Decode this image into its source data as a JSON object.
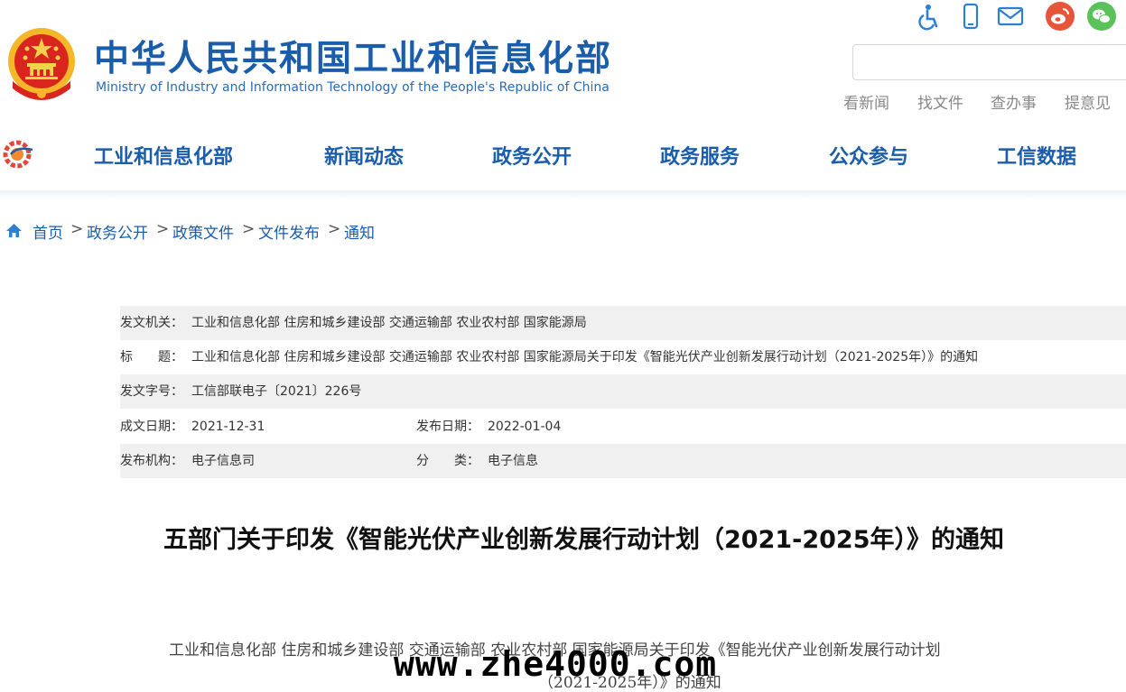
{
  "header": {
    "title_cn": "中华人民共和国工业和信息化部",
    "title_en": "Ministry of Industry and Information Technology of the People's Republic of China",
    "top_icons": [
      "accessibility-icon",
      "mobile-icon",
      "mail-icon",
      "weibo-icon",
      "wechat-icon"
    ],
    "search": {
      "value": "",
      "placeholder": ""
    },
    "quick_links": [
      "看新闻",
      "找文件",
      "查办事",
      "提意见"
    ]
  },
  "nav": {
    "items": [
      "工业和信息化部",
      "新闻动态",
      "政务公开",
      "政务服务",
      "公众参与",
      "工信数据"
    ]
  },
  "breadcrumb": {
    "items": [
      "首页",
      "政务公开",
      "政策文件",
      "文件发布",
      "通知"
    ],
    "separator": ">"
  },
  "meta": {
    "issuer": {
      "label": "发文机关：",
      "value": "工业和信息化部 住房和城乡建设部 交通运输部 农业农村部 国家能源局"
    },
    "title": {
      "label": "标　　题：",
      "value": "工业和信息化部 住房和城乡建设部 交通运输部 农业农村部 国家能源局关于印发《智能光伏产业创新发展行动计划（2021-2025年）》的通知"
    },
    "doc_no": {
      "label": "发文字号：",
      "value": "工信部联电子〔2021〕226号"
    },
    "written_date": {
      "label": "成文日期：",
      "value": "2021-12-31"
    },
    "publish_date": {
      "label": "发布日期：",
      "value": "2022-01-04"
    },
    "agency": {
      "label": "发布机构：",
      "value": "电子信息司"
    },
    "category": {
      "label": "分　　类：",
      "value": "电子信息"
    }
  },
  "article": {
    "title": "五部门关于印发《智能光伏产业创新发展行动计划（2021-2025年）》的通知",
    "body_lines": [
      "工业和信息化部 住房和城乡建设部 交通运输部 农业农村部 国家能源局关于印发《智能光伏产业创新发展行动计划",
      "（2021-2025年）》的通知"
    ]
  },
  "watermark": "www.zhe4000.com",
  "colors": {
    "brand_blue": "#1a5dab",
    "weibo_red": "#e6553a",
    "wechat_green": "#5bc25b",
    "table_shade": "#f0f0f0"
  }
}
